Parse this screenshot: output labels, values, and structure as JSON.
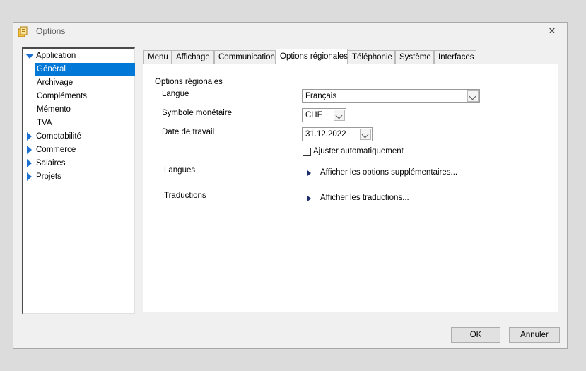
{
  "window": {
    "title": "Options",
    "close_symbol": "✕"
  },
  "tree": {
    "items": [
      {
        "label": "Application",
        "expanded": true
      },
      {
        "label": "Général",
        "selected": true
      },
      {
        "label": "Archivage"
      },
      {
        "label": "Compléments"
      },
      {
        "label": "Mémento"
      },
      {
        "label": "TVA"
      },
      {
        "label": "Comptabilité"
      },
      {
        "label": "Commerce"
      },
      {
        "label": "Salaires"
      },
      {
        "label": "Projets"
      }
    ]
  },
  "tabs": [
    {
      "label": "Menu"
    },
    {
      "label": "Affichage"
    },
    {
      "label": "Communication"
    },
    {
      "label": "Options régionales",
      "active": true
    },
    {
      "label": "Téléphonie"
    },
    {
      "label": "Système"
    },
    {
      "label": "Interfaces"
    }
  ],
  "regional": {
    "group_title": "Options régionales",
    "language_label": "Langue",
    "language_value": "Français",
    "currency_label": "Symbole monétaire",
    "currency_value": "CHF",
    "workdate_label": "Date de travail",
    "workdate_value": "31.12.2022",
    "auto_adjust_label": "Ajuster automatiquement",
    "auto_adjust_checked": false,
    "languages_label": "Langues",
    "languages_link": "Afficher les options supplémentaires...",
    "translations_label": "Traductions",
    "translations_link": "Afficher les traductions..."
  },
  "buttons": {
    "ok": "OK",
    "cancel": "Annuler"
  },
  "colors": {
    "selection": "#0078d7",
    "tree_arrow": "#1a6fd0"
  }
}
